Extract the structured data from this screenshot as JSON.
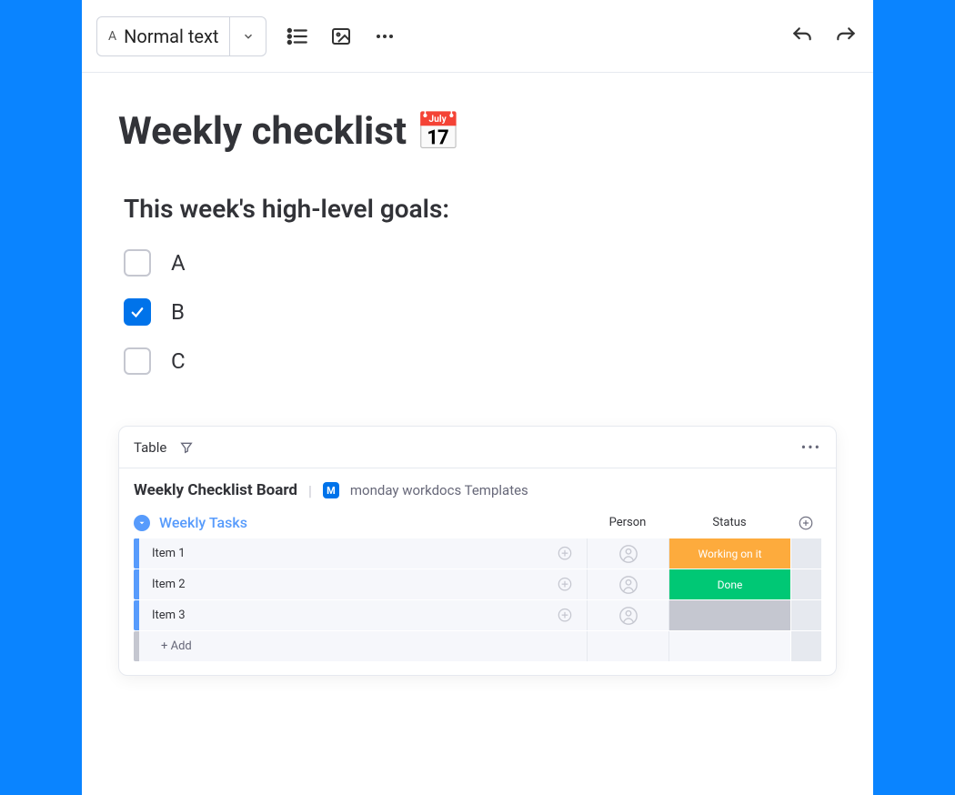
{
  "toolbar": {
    "style_label": "Normal text"
  },
  "doc": {
    "title": "Weekly checklist",
    "emoji": "📅"
  },
  "goals": {
    "heading": "This week's high-level goals:",
    "items": [
      {
        "label": "A",
        "checked": false
      },
      {
        "label": "B",
        "checked": true
      },
      {
        "label": "C",
        "checked": false
      }
    ]
  },
  "board": {
    "tab": "Table",
    "title": "Weekly Checklist Board",
    "workspace_badge": "M",
    "workspace": "monday workdocs Templates",
    "group_name": "Weekly Tasks",
    "columns": {
      "person": "Person",
      "status": "Status"
    },
    "rows": [
      {
        "name": "Item 1",
        "status_label": "Working on it",
        "status_kind": "working"
      },
      {
        "name": "Item 2",
        "status_label": "Done",
        "status_kind": "done"
      },
      {
        "name": "Item 3",
        "status_label": "",
        "status_kind": "empty"
      }
    ],
    "add_label": "+ Add"
  }
}
